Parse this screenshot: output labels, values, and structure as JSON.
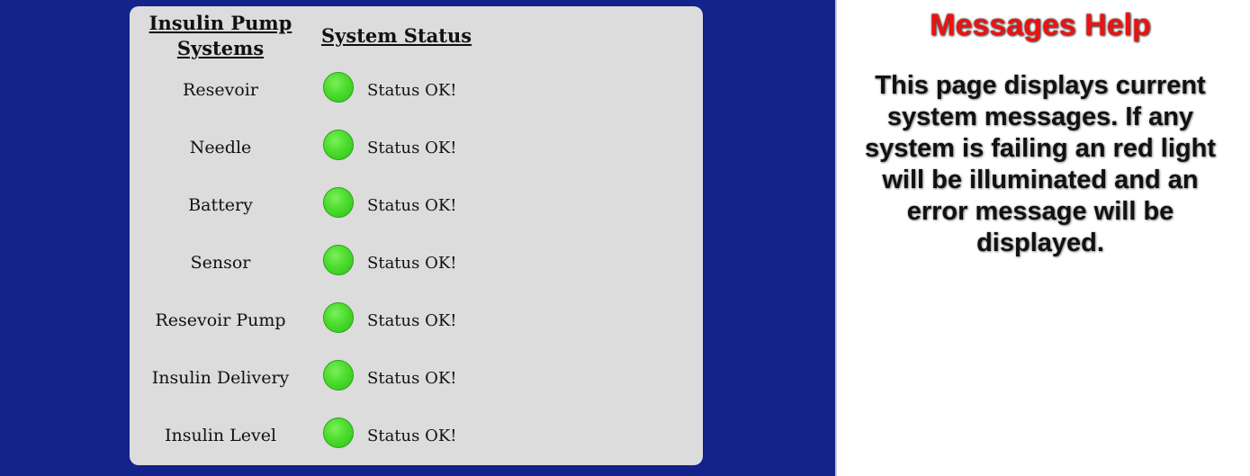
{
  "status_panel": {
    "systems_header": "Insulin Pump Systems",
    "status_header": "System Status",
    "rows": [
      {
        "name": "Resevoir",
        "status": "Status OK!",
        "light": "green"
      },
      {
        "name": "Needle",
        "status": "Status OK!",
        "light": "green"
      },
      {
        "name": "Battery",
        "status": "Status OK!",
        "light": "green"
      },
      {
        "name": "Sensor",
        "status": "Status OK!",
        "light": "green"
      },
      {
        "name": "Resevoir Pump",
        "status": "Status OK!",
        "light": "green"
      },
      {
        "name": "Insulin Delivery",
        "status": "Status OK!",
        "light": "green"
      },
      {
        "name": "Insulin Level",
        "status": "Status OK!",
        "light": "green"
      }
    ]
  },
  "help": {
    "title": "Messages Help",
    "body": "This page displays current system messages. If any system is failing an red light will be illuminated and an error message will be displayed."
  },
  "colors": {
    "background_blue": "#13238b",
    "card_gray": "#dcdcdc",
    "status_ok_green": "#4ddc2e",
    "help_title_red": "#ee1111"
  }
}
